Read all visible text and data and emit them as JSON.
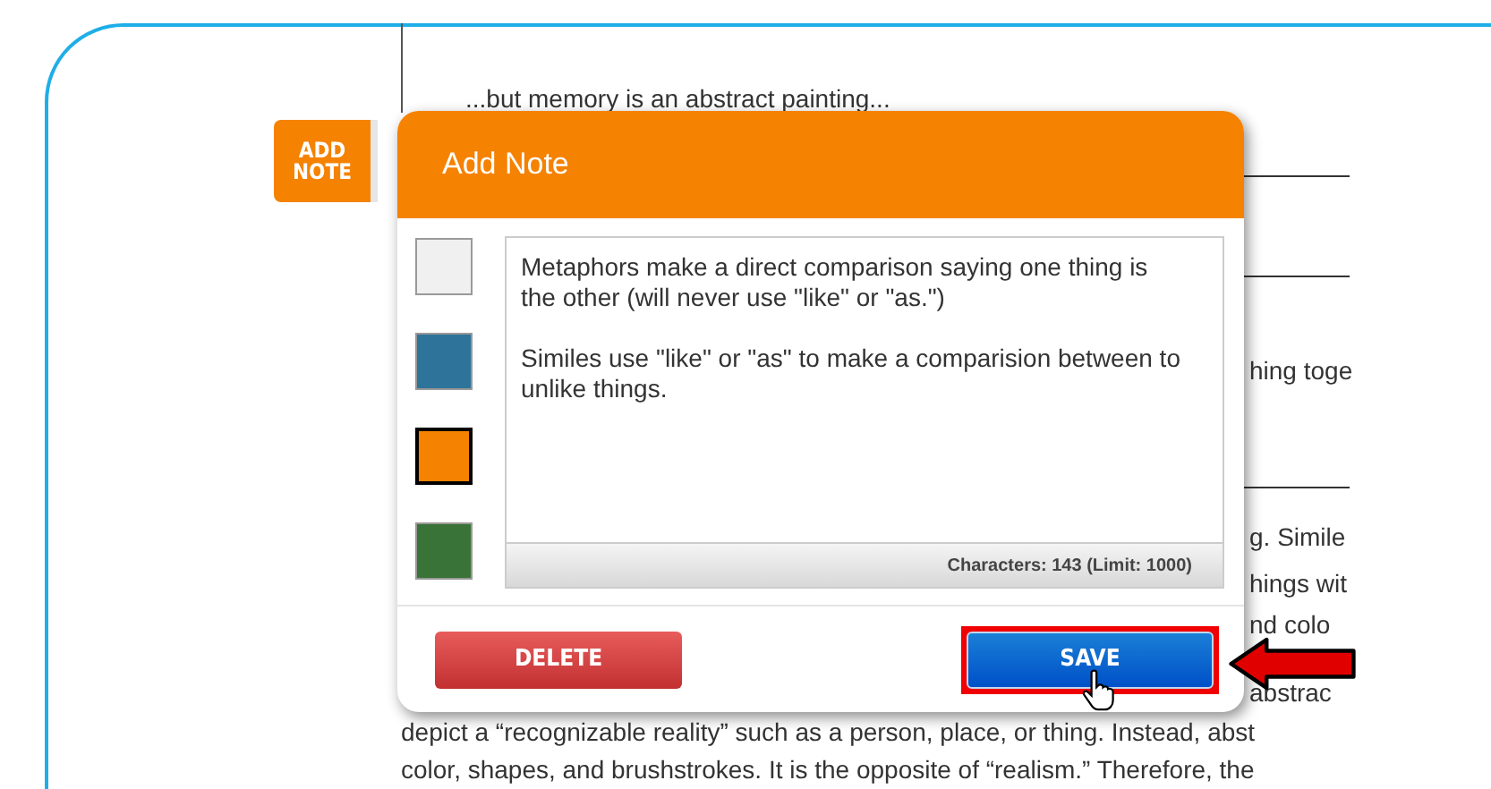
{
  "add_note_tab": {
    "label": "ADD NOTE"
  },
  "document": {
    "items": [
      {
        "kind": "text",
        "text": "...but memory is an abstract painting..."
      },
      {
        "kind": "rule"
      },
      {
        "kind": "rule"
      },
      {
        "kind": "fragment",
        "text": "hing toge"
      },
      {
        "kind": "rule"
      },
      {
        "kind": "fragment",
        "text": "g. Simile"
      },
      {
        "kind": "fragment",
        "text": "hings wit"
      },
      {
        "kind": "fragment",
        "text": "nd colo"
      },
      {
        "kind": "fragment",
        "text": "abstrac"
      },
      {
        "kind": "full",
        "text": "depict a “recognizable reality” such as a person, place, or thing. Instead, abst"
      },
      {
        "kind": "full",
        "text": "color, shapes, and brushstrokes. It is the opposite of “realism.” Therefore, the"
      }
    ]
  },
  "dialog": {
    "title": "Add Note",
    "swatches": [
      {
        "color": "#f0f0f0",
        "selected": false
      },
      {
        "color": "#2e7399",
        "selected": false
      },
      {
        "color": "#f58200",
        "selected": true
      },
      {
        "color": "#3a7337",
        "selected": false
      }
    ],
    "note": {
      "value": "Metaphors make a direct comparison saying one thing is the other (will never use \"like\" or \"as.\")\n\nSimiles use \"like\" or \"as\" to make a comparision between to unlike things."
    },
    "counter": "Characters: 143 (Limit: 1000)",
    "buttons": [
      {
        "label": "DELETE",
        "kind": "delete",
        "highlighted": false
      },
      {
        "label": "SAVE",
        "kind": "save",
        "highlighted": true
      }
    ]
  }
}
